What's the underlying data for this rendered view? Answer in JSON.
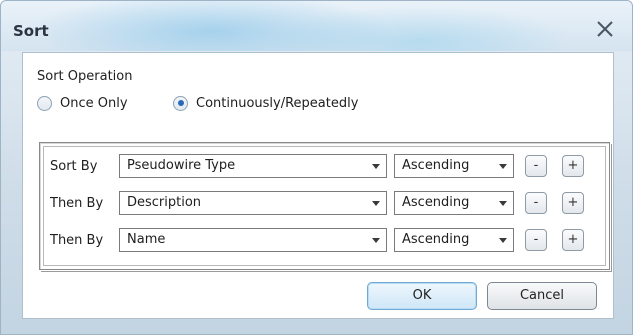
{
  "window": {
    "title": "Sort",
    "close_icon": "close-icon"
  },
  "sort_operation": {
    "label": "Sort Operation",
    "options": [
      {
        "label": "Once Only",
        "selected": false
      },
      {
        "label": "Continuously/Repeatedly",
        "selected": true
      }
    ]
  },
  "sort_rows": [
    {
      "label": "Sort By",
      "field": "Pseudowire Type",
      "order": "Ascending",
      "remove_label": "-",
      "add_label": "+"
    },
    {
      "label": "Then By",
      "field": "Description",
      "order": "Ascending",
      "remove_label": "-",
      "add_label": "+"
    },
    {
      "label": "Then By",
      "field": "Name",
      "order": "Ascending",
      "remove_label": "-",
      "add_label": "+"
    }
  ],
  "buttons": {
    "ok_label": "OK",
    "cancel_label": "Cancel"
  },
  "colors": {
    "selected_radio": "#2a68b8",
    "ok_border": "#6fa8d4"
  }
}
